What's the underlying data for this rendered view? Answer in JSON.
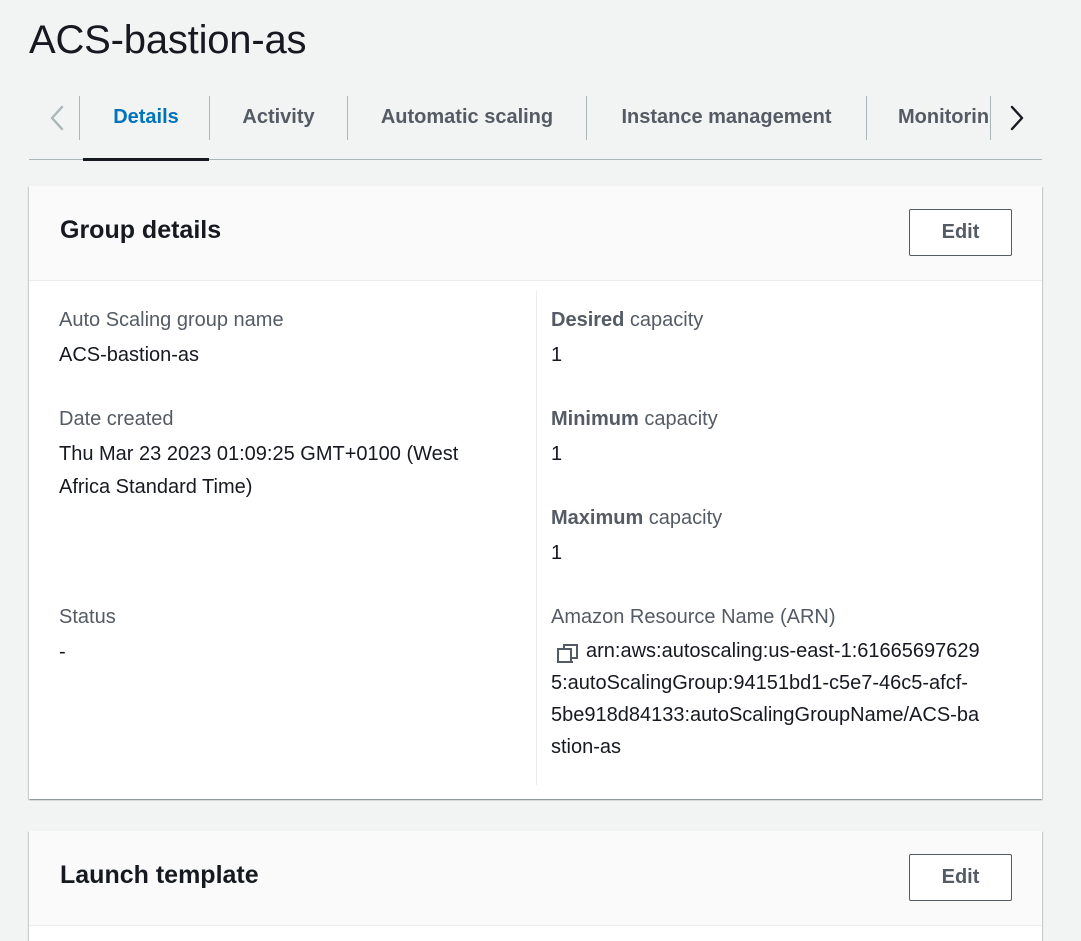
{
  "page": {
    "title": "ACS-bastion-as"
  },
  "tabs": {
    "items": [
      {
        "label": "Details",
        "active": true
      },
      {
        "label": "Activity",
        "active": false
      },
      {
        "label": "Automatic scaling",
        "active": false
      },
      {
        "label": "Instance management",
        "active": false
      },
      {
        "label": "Monitoring",
        "active": false
      }
    ],
    "scroll_left_icon": "chevron-left-icon",
    "scroll_right_icon": "chevron-right-icon"
  },
  "group_details": {
    "title": "Group details",
    "edit_label": "Edit",
    "name_label": "Auto Scaling group name",
    "name_value": "ACS-bastion-as",
    "date_label": "Date created",
    "date_value": "Thu Mar 23 2023 01:09:25 GMT+0100 (West Africa Standard Time)",
    "status_label": "Status",
    "status_value": "-",
    "desired_bold": "Desired",
    "desired_rest": " capacity",
    "desired_value": "1",
    "minimum_bold": "Minimum",
    "minimum_rest": " capacity",
    "minimum_value": "1",
    "maximum_bold": "Maximum",
    "maximum_rest": " capacity",
    "maximum_value": "1",
    "arn_label": "Amazon Resource Name (ARN)",
    "arn_line1": "arn:aws:autoscaling:us-east-1:61665697629",
    "arn_line2": "5:autoScalingGroup:94151bd1-c5e7-46c5-afcf-",
    "arn_line3": "5be918d84133:autoScalingGroupName/ACS-ba",
    "arn_line4": "stion-as",
    "copy_icon": "copy-icon"
  },
  "launch_template": {
    "title": "Launch template",
    "edit_label": "Edit"
  },
  "colors": {
    "accent": "#0073bb",
    "text": "#16191f",
    "muted": "#545b64",
    "background": "#f2f3f3"
  }
}
